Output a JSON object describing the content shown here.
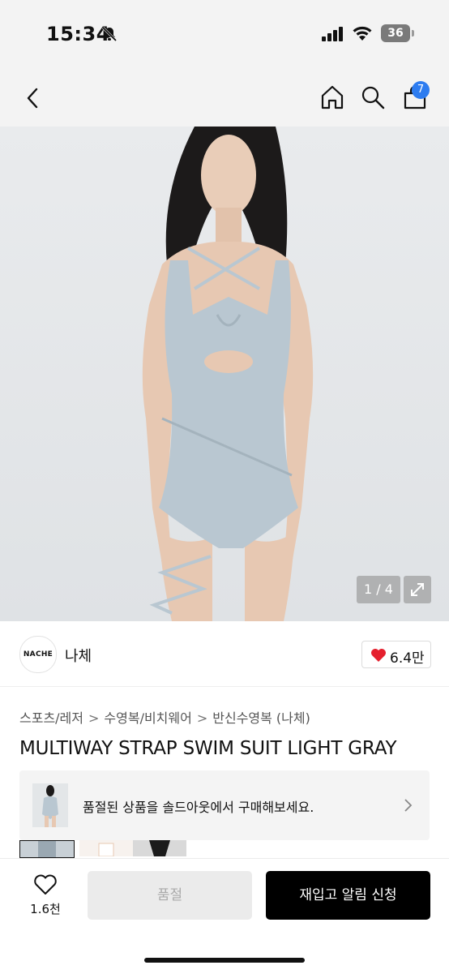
{
  "status_bar": {
    "time": "15:34",
    "battery": "36"
  },
  "header": {
    "cart_count": "7"
  },
  "gallery": {
    "pager": "1 / 4"
  },
  "brand": {
    "logo_text": "NACHE",
    "name": "나체",
    "likes": "6.4만",
    "heart_color": "#e5202e"
  },
  "breadcrumb": [
    "스포츠/레저",
    "수영복/비치웨어",
    "반신수영복 (나체)"
  ],
  "product": {
    "title": "MULTIWAY STRAP SWIM SUIT LIGHT GRAY"
  },
  "soldout_banner": {
    "text": "품절된 상품을 솔드아웃에서 구매해보세요."
  },
  "bottom_bar": {
    "wish_count": "1.6천",
    "soldout_label": "품절",
    "restock_label": "재입고 알림 신청"
  },
  "colors": {
    "accent": "#2d7cf0",
    "primary_button": "#000000",
    "disabled_button": "#ebebeb"
  }
}
